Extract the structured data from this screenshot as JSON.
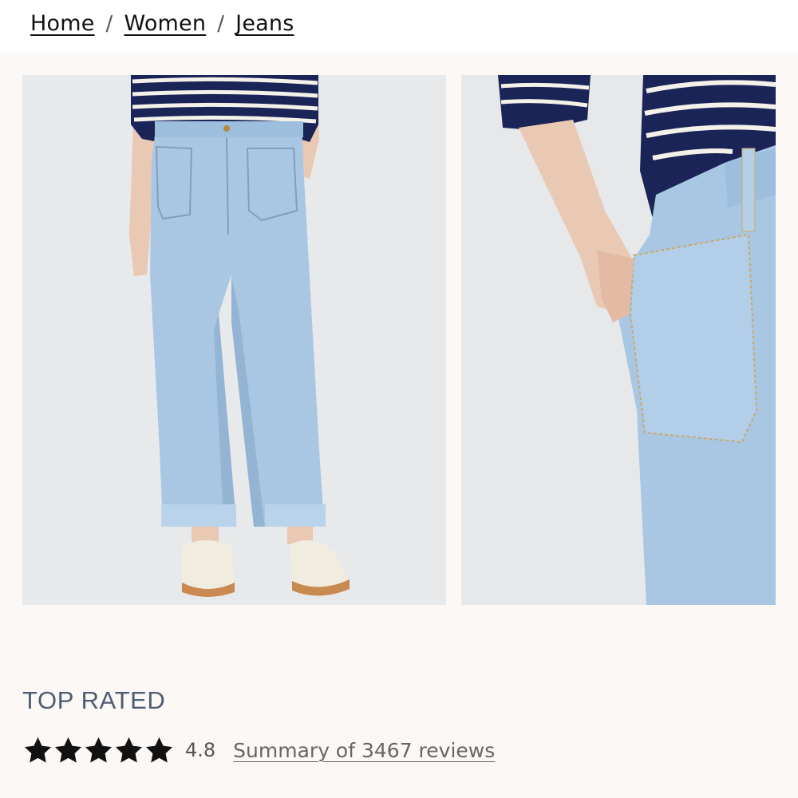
{
  "breadcrumb": {
    "items": [
      "Home",
      "Women",
      "Jeans"
    ],
    "separator": "/"
  },
  "gallery": {
    "images": [
      {
        "alt": "model-front-view",
        "subject": "light wash wide-leg jeans with striped knit sweater and cream sneakers"
      },
      {
        "alt": "model-pocket-detail",
        "subject": "close-up of front patch pocket with hand in pocket"
      }
    ]
  },
  "product": {
    "badge": "TOP RATED",
    "rating": {
      "value": "4.8",
      "stars_filled": 5,
      "stars_total": 5,
      "reviews_link": "Summary of 3467 reviews"
    }
  },
  "colors": {
    "background": "#fbf8f5",
    "badge_text": "#4e5d73",
    "star": "#111111",
    "denim": "#a9c7e3",
    "sweater_navy": "#1b2456"
  }
}
